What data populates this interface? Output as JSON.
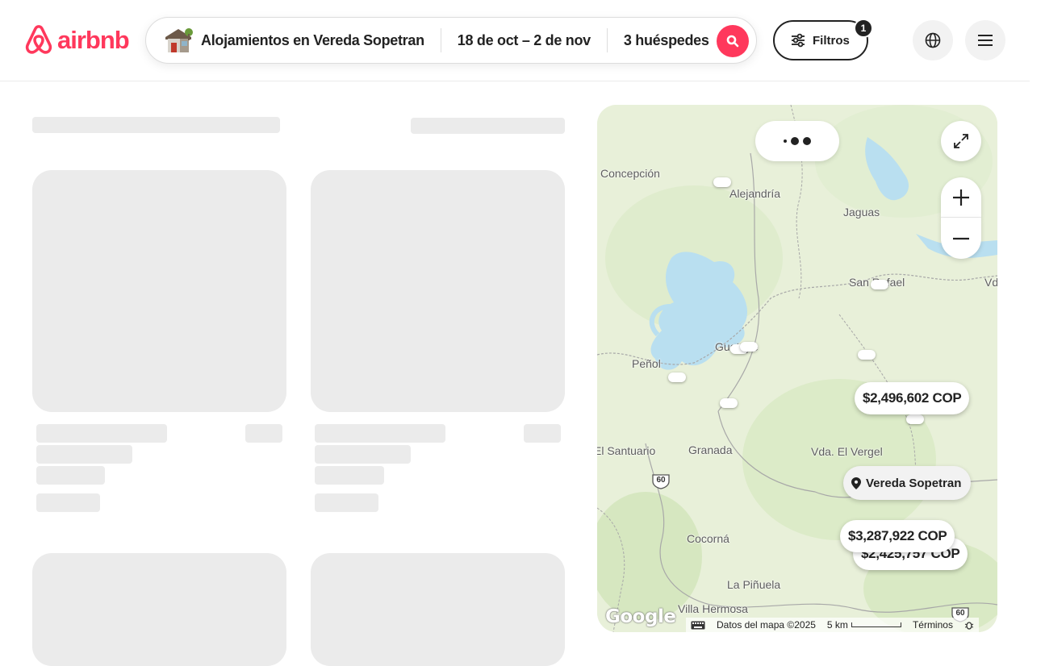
{
  "brand": {
    "name": "airbnb",
    "color": "#ff385c"
  },
  "search": {
    "location": "Alojamientos en Vereda Sopetran",
    "dates": "18 de oct – 2 de nov",
    "guests": "3 huéspedes",
    "house_icon": "house-icon",
    "button_icon": "search-icon"
  },
  "filters": {
    "label": "Filtros",
    "count": "1",
    "icon": "sliders-icon"
  },
  "header_buttons": {
    "language_icon": "globe-icon",
    "menu_icon": "hamburger-menu-icon"
  },
  "listings": {
    "state": "loading",
    "skeleton_cards": 4
  },
  "map": {
    "places": [
      {
        "name": "Concepción"
      },
      {
        "name": "Alejandría"
      },
      {
        "name": "Jaguas"
      },
      {
        "name": "San Rafael"
      },
      {
        "name": "Vd"
      },
      {
        "name": "Guatape"
      },
      {
        "name": "Peñol"
      },
      {
        "name": "El Santuario"
      },
      {
        "name": "Granada"
      },
      {
        "name": "Vda. El Vergel"
      },
      {
        "name": "Cocorná"
      },
      {
        "name": "La Piñuela"
      },
      {
        "name": "Villa Hermosa"
      }
    ],
    "price_pins": [
      "$2,496,602 COP",
      "$3,287,922 COP",
      "$2,425,757 COP"
    ],
    "location_pin": "Vereda Sopetran",
    "route_shield": "60",
    "attribution": {
      "google": "Google",
      "data": "Datos del mapa ©2025",
      "scale": "5 km",
      "terms": "Términos"
    },
    "controls": {
      "expand_icon": "expand-icon",
      "zoom_in_icon": "plus-icon",
      "zoom_out_icon": "minus-icon",
      "keyboard_icon": "keyboard-icon",
      "bug_icon": "bug-report-icon"
    },
    "colors": {
      "land": "#e8f0d9",
      "water": "#b9dff0",
      "border": "#9a9a9a"
    }
  }
}
